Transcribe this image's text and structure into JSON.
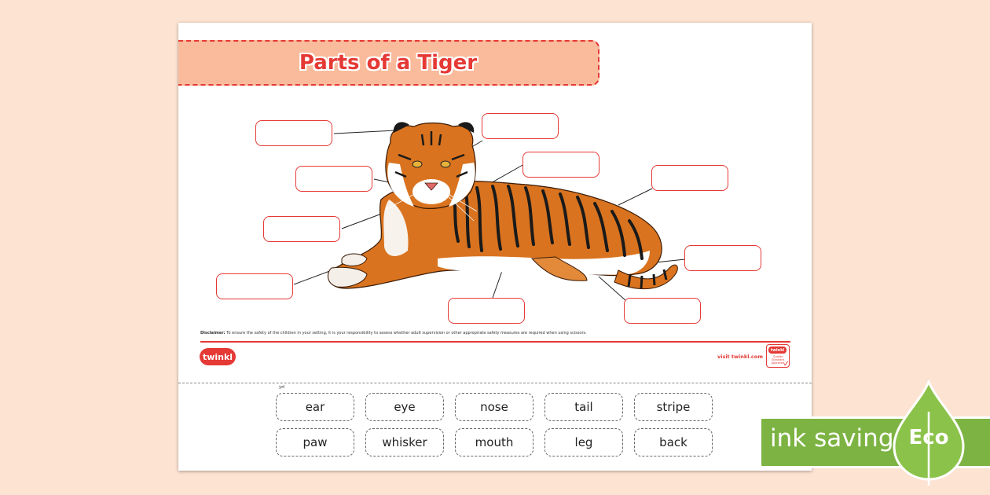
{
  "worksheet": {
    "title": "Parts of a Tiger",
    "disclaimer_label": "Disclaimer:",
    "disclaimer_text": " To ensure the safety of the children in your setting, it is your responsibility to assess whether adult supervision or other appropriate safety measures are required when using scissors.",
    "brand": "twinkl",
    "visit_link": "visit twinkl.com",
    "badge_top": "twinkl",
    "badge_text": "Quality Standard Approved"
  },
  "word_cards": [
    "ear",
    "eye",
    "nose",
    "tail",
    "stripe",
    "paw",
    "whisker",
    "mouth",
    "leg",
    "back"
  ],
  "eco_badge": {
    "text": "ink saving",
    "label": "Eco",
    "color": "#7cb342"
  },
  "colors": {
    "accent": "#e53935",
    "background": "#fde3d2",
    "banner": "#f9bb9b",
    "tiger_orange": "#d9731f"
  }
}
